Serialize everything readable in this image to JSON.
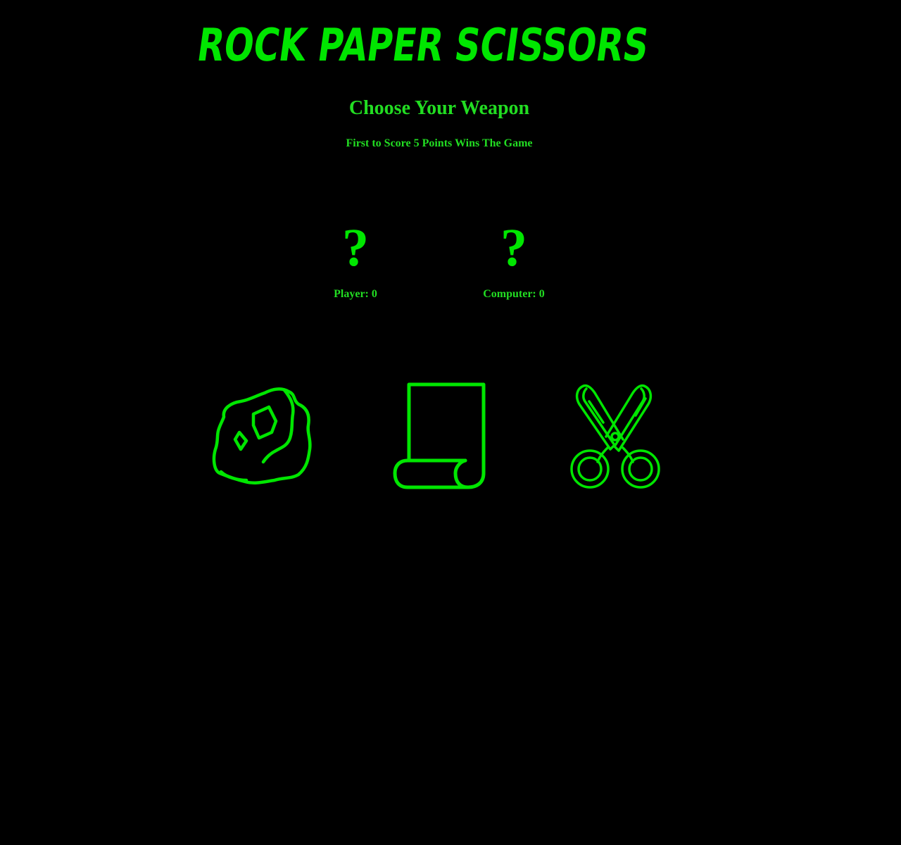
{
  "header": {
    "title": "Rock Paper Scissors"
  },
  "intro": {
    "heading": "Choose Your Weapon",
    "rules": "First to Score 5 Points Wins The Game"
  },
  "scoreboard": {
    "player": {
      "choice": "?",
      "label": "Player: 0"
    },
    "computer": {
      "choice": "?",
      "label": "Computer: 0"
    }
  },
  "weapons": [
    {
      "name": "rock",
      "icon": "rock-icon"
    },
    {
      "name": "paper",
      "icon": "paper-scroll-icon"
    },
    {
      "name": "scissors",
      "icon": "scissors-icon"
    }
  ],
  "colors": {
    "background": "#000000",
    "neon_green": "#00e600",
    "text_green": "#22dd22"
  }
}
